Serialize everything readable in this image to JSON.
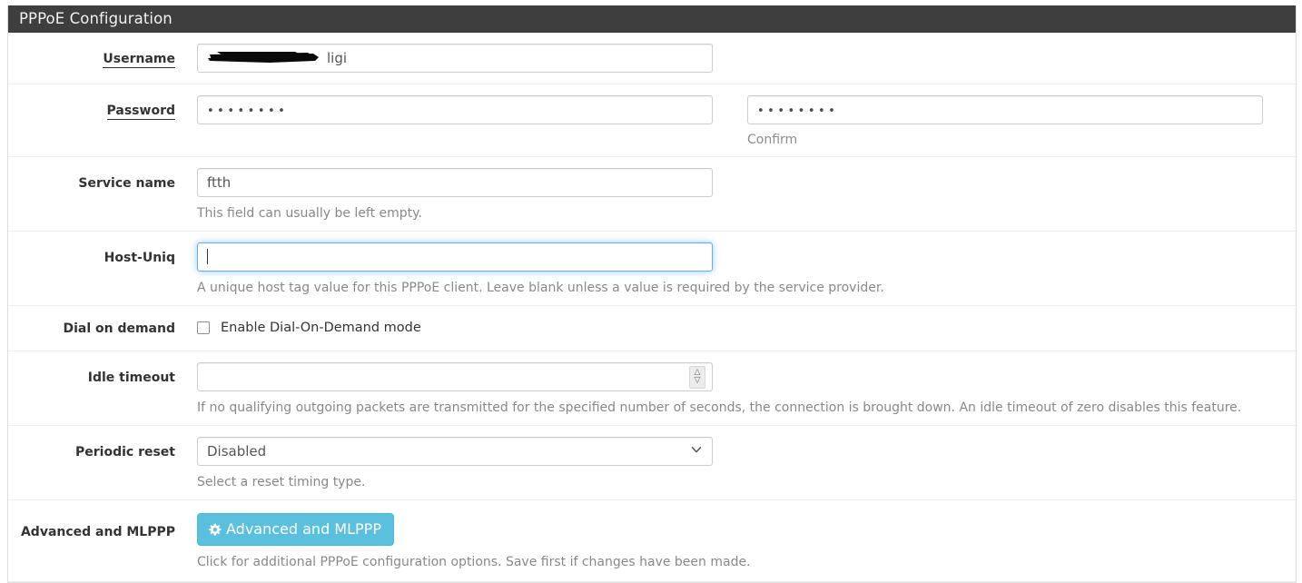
{
  "panel": {
    "title": "PPPoE Configuration"
  },
  "fields": {
    "username": {
      "label": "Username",
      "value": "ligi",
      "placeholder": ""
    },
    "password": {
      "label": "Password",
      "value": "••••••••",
      "confirm_value": "••••••••",
      "confirm_help": "Confirm"
    },
    "service_name": {
      "label": "Service name",
      "value": "ftth",
      "help": "This field can usually be left empty."
    },
    "host_uniq": {
      "label": "Host-Uniq",
      "value": "",
      "help": "A unique host tag value for this PPPoE client. Leave blank unless a value is required by the service provider."
    },
    "dial_on_demand": {
      "label": "Dial on demand",
      "checkbox_label": "Enable Dial-On-Demand mode",
      "checked": false
    },
    "idle_timeout": {
      "label": "Idle timeout",
      "value": "",
      "help": "If no qualifying outgoing packets are transmitted for the specified number of seconds, the connection is brought down. An idle timeout of zero disables this feature."
    },
    "periodic_reset": {
      "label": "Periodic reset",
      "selected": "Disabled",
      "options": [
        "Disabled"
      ],
      "help": "Select a reset timing type."
    },
    "advanced": {
      "label": "Advanced and MLPPP",
      "button_label": "Advanced and MLPPP",
      "button_icon": "gear-icon",
      "help": "Click for additional PPPoE configuration options. Save first if changes have been made."
    }
  },
  "colors": {
    "header_bg": "#3e3e3e",
    "button_info": "#5bc0de",
    "focus_ring": "#66afe9",
    "help_text": "#888888"
  }
}
